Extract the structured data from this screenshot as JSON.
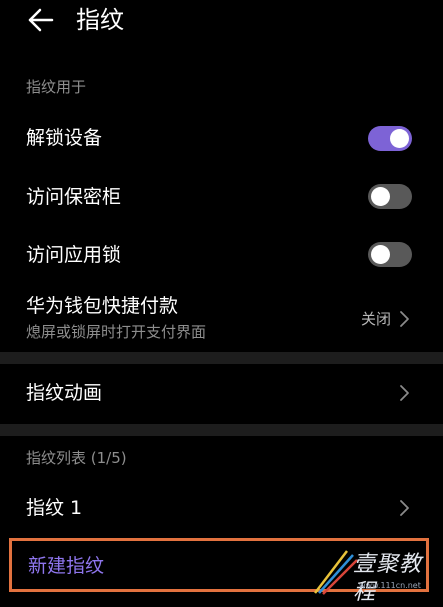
{
  "header": {
    "title": "指纹",
    "back_icon": "back-arrow-icon"
  },
  "usage_section": {
    "label": "指纹用于",
    "items": [
      {
        "label": "解锁设备",
        "toggle_on": true
      },
      {
        "label": "访问保密柜",
        "toggle_on": false
      },
      {
        "label": "访问应用锁",
        "toggle_on": false
      }
    ]
  },
  "wallet": {
    "label": "华为钱包快捷付款",
    "sublabel": "熄屏或锁屏时打开支付界面",
    "value": "关闭"
  },
  "animation": {
    "label": "指纹动画"
  },
  "list_section": {
    "label": "指纹列表 (1/5)",
    "items": [
      {
        "label": "指纹 1"
      }
    ],
    "new_label": "新建指纹"
  },
  "watermark": {
    "text": "壹聚教程",
    "sub": "www.111cn.net"
  },
  "colors": {
    "background": "#000000",
    "toggle_on": "#7d63d6",
    "toggle_off": "#595959",
    "accent_text": "#8f76ee",
    "highlight_border": "#e2723f",
    "divider": "#1d1d1d"
  }
}
